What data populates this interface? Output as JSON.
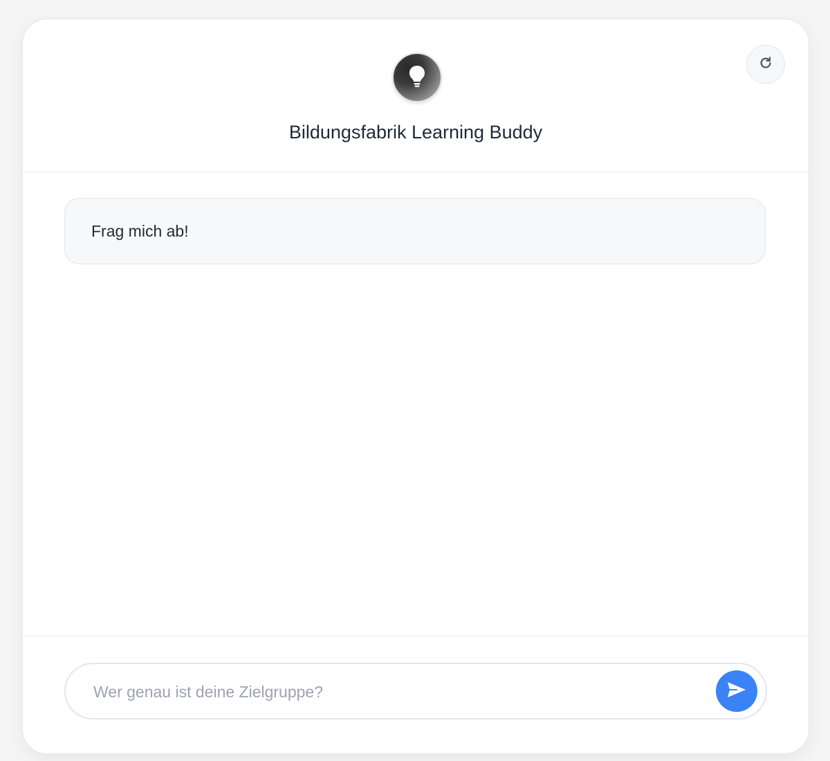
{
  "header": {
    "title": "Bildungsfabrik Learning Buddy",
    "avatar_icon": "lightbulb-icon",
    "refresh_icon": "refresh-icon"
  },
  "messages": [
    {
      "role": "assistant",
      "text": "Frag mich ab!"
    }
  ],
  "composer": {
    "placeholder": "Wer genau ist deine Zielgruppe?",
    "value": "",
    "send_icon": "send-icon"
  },
  "colors": {
    "accent": "#3b82f6",
    "text": "#1f2937",
    "placeholder": "#9ca3af",
    "bubble_bg": "#f7f8fa"
  }
}
